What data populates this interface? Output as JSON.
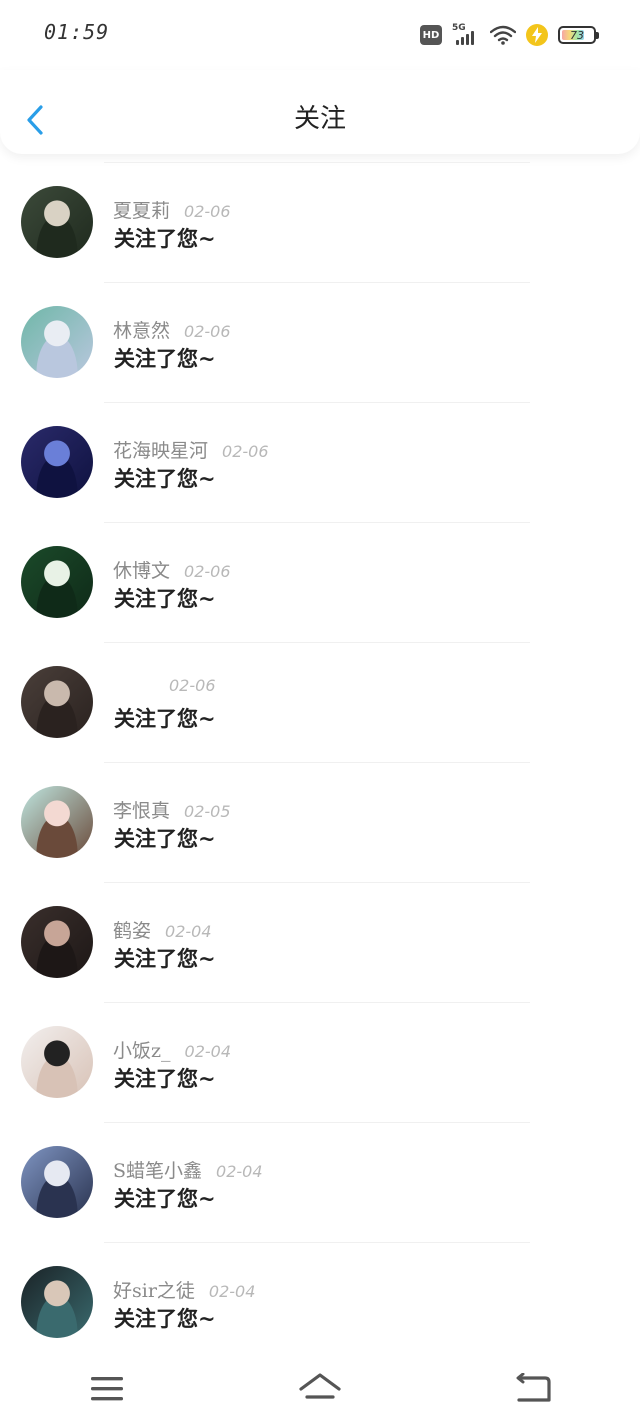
{
  "status_bar": {
    "time": "01:59",
    "hd_label": "HD",
    "network_label": "5G",
    "battery_level": "73",
    "battery_fraction": 0.73
  },
  "header": {
    "title": "关注"
  },
  "icons": {
    "back": "chevron-left-icon",
    "menu": "menu-icon",
    "home": "home-icon",
    "return": "return-icon"
  },
  "colors": {
    "accent": "#2a9ee8",
    "name_gray": "#8a8a8a",
    "date_gray": "#b8b8b8"
  },
  "items": [
    {
      "name": "夏夏莉",
      "date": "02-06",
      "message": "关注了您~",
      "avatar_colors": [
        "#3c4a3a",
        "#d9d2c4",
        "#1f2a1e"
      ]
    },
    {
      "name": "林意然",
      "date": "02-06",
      "message": "关注了您~",
      "avatar_colors": [
        "#6fb7a8",
        "#e9edf3",
        "#b9c7de"
      ]
    },
    {
      "name": "花海映星河",
      "date": "02-06",
      "message": "关注了您~",
      "avatar_colors": [
        "#2a2a6a",
        "#6a7fd8",
        "#0f1240"
      ]
    },
    {
      "name": "休博文",
      "date": "02-06",
      "message": "关注了您~",
      "avatar_colors": [
        "#1b4a2a",
        "#e8f2e6",
        "#0f2a18"
      ]
    },
    {
      "name": "",
      "date": "02-06",
      "message": "关注了您~",
      "avatar_colors": [
        "#4a3f3a",
        "#c9b9ad",
        "#2a221f"
      ]
    },
    {
      "name": "李恨真",
      "date": "02-05",
      "message": "关注了您~",
      "avatar_colors": [
        "#bfe6e0",
        "#f3d9d2",
        "#6a4a3a"
      ]
    },
    {
      "name": "鹤姿",
      "date": "02-04",
      "message": "关注了您~",
      "avatar_colors": [
        "#3a2f2c",
        "#c7a597",
        "#1d1716"
      ]
    },
    {
      "name": "小饭z_",
      "date": "02-04",
      "message": "关注了您~",
      "avatar_colors": [
        "#f2efee",
        "#222222",
        "#d8c2b6"
      ]
    },
    {
      "name": "S蜡笔小鑫",
      "date": "02-04",
      "message": "关注了您~",
      "avatar_colors": [
        "#7f95c2",
        "#e6e9f2",
        "#2a3350"
      ]
    },
    {
      "name": "好sir之徒",
      "date": "02-04",
      "message": "关注了您~",
      "avatar_colors": [
        "#1a2226",
        "#d9c7b8",
        "#3a6a6e"
      ]
    }
  ]
}
